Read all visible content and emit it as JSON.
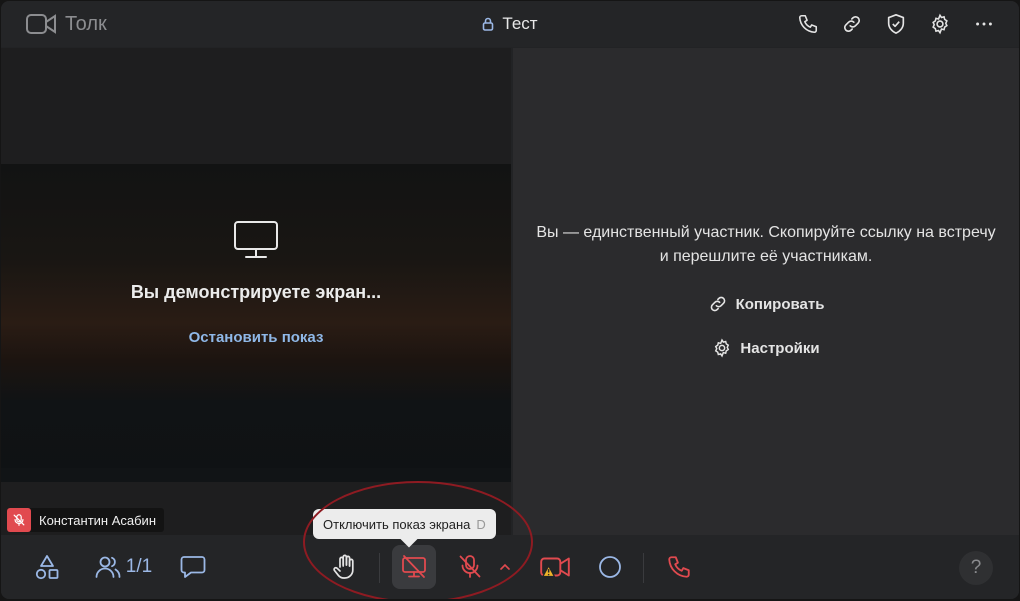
{
  "app": {
    "name": "Толк",
    "icon": "video-camera-icon"
  },
  "meeting": {
    "title": "Тест",
    "lock_icon": "lock-icon"
  },
  "header_actions": [
    {
      "id": "phone",
      "icon": "phone-icon"
    },
    {
      "id": "link",
      "icon": "link-icon"
    },
    {
      "id": "security",
      "icon": "shield-check-icon"
    },
    {
      "id": "settings",
      "icon": "gear-icon"
    },
    {
      "id": "more",
      "icon": "more-icon"
    }
  ],
  "screen_share": {
    "message": "Вы демонстрируете экран...",
    "stop_label": "Остановить показ",
    "icon": "monitor-icon"
  },
  "invite_panel": {
    "message": "Вы — единственный участник. Скопируйте ссылку на встречу и перешлите её участникам.",
    "copy_label": "Копировать",
    "settings_label": "Настройки"
  },
  "participant": {
    "name": "Константин Асабин",
    "mic": "muted"
  },
  "tooltip": {
    "text": "Отключить показ экрана",
    "shortcut": "D"
  },
  "toolbar": {
    "participants_count": "1/1",
    "help_label": "?"
  },
  "colors": {
    "accent": "#9bb8e6",
    "danger": "#e14a4f",
    "link": "#8fb8e8",
    "warning": "#f0b429"
  }
}
